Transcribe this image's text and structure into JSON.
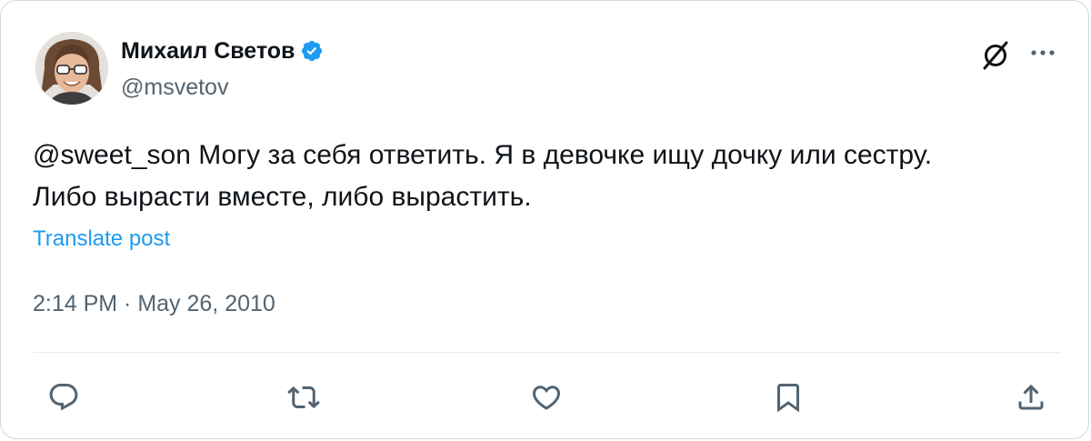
{
  "author": {
    "display_name": "Михаил Светов",
    "handle": "@msvetov",
    "verified": true
  },
  "tweet": {
    "mention": "@sweet_son",
    "text_line1_rest": " Могу за себя ответить. Я в девочке ищу дочку или сестру.",
    "text_line2": "Либо вырасти вместе, либо вырастить.",
    "translate_label": "Translate post",
    "timestamp": "2:14 PM · May 26, 2010"
  },
  "colors": {
    "accent": "#1d9bf0",
    "secondary_text": "#536471",
    "primary_text": "#0f1419",
    "border": "#cfd9de"
  },
  "icons": {
    "header": [
      "grok-icon",
      "more-icon"
    ],
    "actions": [
      "reply-icon",
      "retweet-icon",
      "like-icon",
      "bookmark-icon",
      "share-icon"
    ]
  }
}
